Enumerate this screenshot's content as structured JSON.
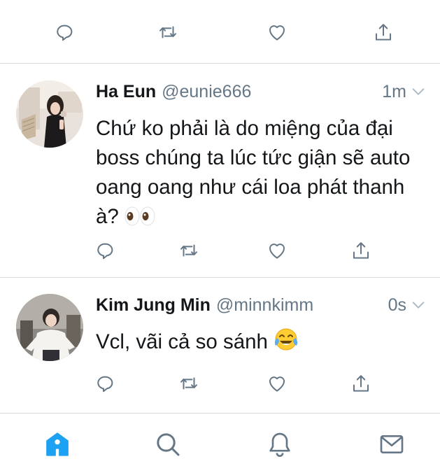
{
  "colors": {
    "icon": "#657786",
    "text": "#14171a",
    "secondary": "#657786",
    "accent": "#1da1f2",
    "divider": "#d6dbdf"
  },
  "tweets": [
    {
      "name": "Ha Eun",
      "handle": "@eunie666",
      "time": "1m",
      "text": "Chứ ko phải là do miệng của đại boss chúng ta lúc tức giận sẽ auto oang oang như cái loa phát thanh à?",
      "emoji": "eyes-emoji"
    },
    {
      "name": "Kim Jung Min",
      "handle": "@minnkimm",
      "time": "0s",
      "text": "Vcl, vãi cả so sánh",
      "emoji": "tears-of-joy-emoji"
    }
  ],
  "actions": [
    "reply-icon",
    "retweet-icon",
    "like-icon",
    "share-icon"
  ],
  "tabbar": {
    "items": [
      "home-icon",
      "search-icon",
      "notifications-icon",
      "messages-icon"
    ],
    "active": "home-icon"
  }
}
